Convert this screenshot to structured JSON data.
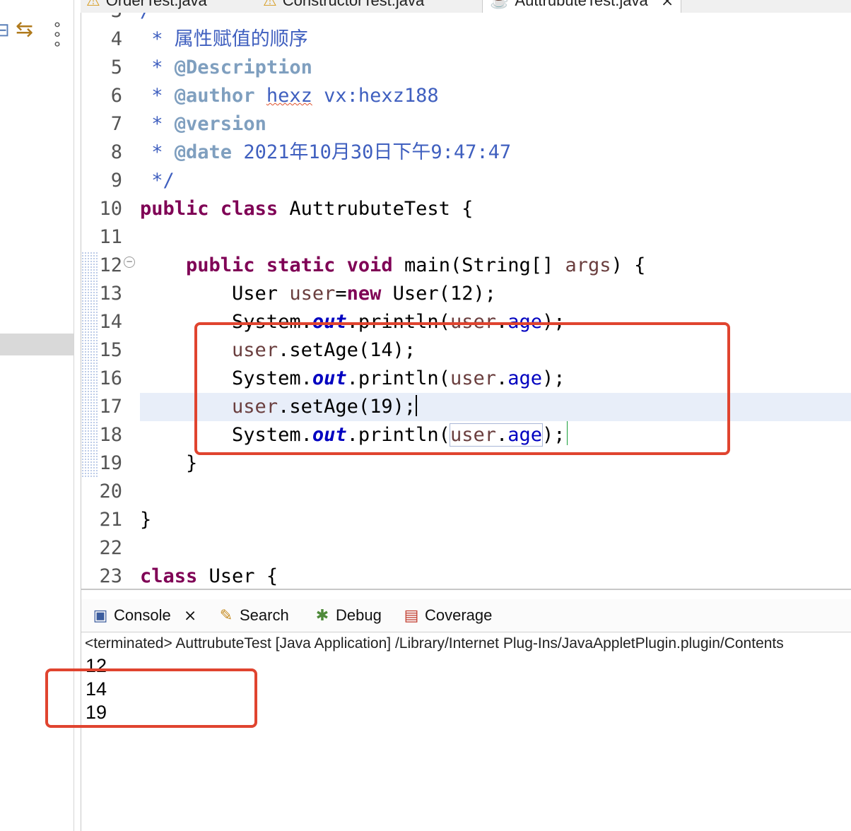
{
  "colors": {
    "highlight_box": "#e0442f",
    "keyword": "#7f0055",
    "comment": "#3f5fbf",
    "field": "#0000c0",
    "local_variable": "#6a3e3e",
    "current_line": "#e8eef9"
  },
  "left_panel": {
    "icons": [
      "collapse-all-icon",
      "link-with-editor-icon",
      "view-menu-icon"
    ]
  },
  "editor_tabs": [
    {
      "label": "OrderTest.java",
      "icon": "warning-icon",
      "active": false
    },
    {
      "label": "ConstructorTest.java",
      "icon": "warning-icon",
      "active": false
    },
    {
      "label": "AuttrubuteTest.java",
      "icon": "java-file-icon",
      "active": true,
      "close": "⨯"
    }
  ],
  "editor": {
    "lines": [
      {
        "num": "4",
        "text": " * 属性赋值的顺序"
      },
      {
        "num": "5",
        "text": " * @Description"
      },
      {
        "num": "6",
        "text": " * @author hexz vx:hexz188"
      },
      {
        "num": "7",
        "text": " * @version"
      },
      {
        "num": "8",
        "text": " * @date 2021年10月30日下午9:47:47"
      },
      {
        "num": "9",
        "text": " */"
      },
      {
        "num": "10",
        "text": "public class AuttrubuteTest {"
      },
      {
        "num": "11",
        "text": ""
      },
      {
        "num": "12",
        "text": "    public static void main(String[] args) {"
      },
      {
        "num": "13",
        "text": "        User user=new User(12);"
      },
      {
        "num": "14",
        "text": "        System.out.println(user.age);"
      },
      {
        "num": "15",
        "text": "        user.setAge(14);"
      },
      {
        "num": "16",
        "text": "        System.out.println(user.age);"
      },
      {
        "num": "17",
        "text": "        user.setAge(19);"
      },
      {
        "num": "18",
        "text": "        System.out.println(user.age);"
      },
      {
        "num": "19",
        "text": "    }"
      },
      {
        "num": "20",
        "text": ""
      },
      {
        "num": "21",
        "text": "}"
      },
      {
        "num": "22",
        "text": ""
      },
      {
        "num": "23",
        "text": "class User {"
      }
    ],
    "tokens": {
      "l4": [
        " * ",
        "属性赋值的顺序"
      ],
      "l5": [
        " * ",
        "@Description"
      ],
      "l6": [
        " * ",
        "@author",
        " ",
        "hexz",
        " vx:hexz188"
      ],
      "l7": [
        " * ",
        "@version"
      ],
      "l8": [
        " * ",
        "@date",
        " 2021年10月30日下午9:47:47"
      ],
      "l9": [
        " */"
      ],
      "l10": [
        "public",
        " ",
        "class",
        " AuttrubuteTest {"
      ],
      "l12": [
        "    ",
        "public",
        " ",
        "static",
        " ",
        "void",
        " main(String[] ",
        "args",
        ") {"
      ],
      "l13": [
        "        User ",
        "user",
        "=",
        "new",
        " User(12);"
      ],
      "l14": [
        "        System.",
        "out",
        ".println(",
        "user",
        ".",
        "age",
        ");"
      ],
      "l15": [
        "        ",
        "user",
        ".setAge(14);"
      ],
      "l16": [
        "        System.",
        "out",
        ".println(",
        "user",
        ".",
        "age",
        ");"
      ],
      "l17": [
        "        ",
        "user",
        ".setAge(19);"
      ],
      "l18": [
        "        System.",
        "out",
        ".println(",
        "user",
        ".",
        "age",
        ");"
      ],
      "l19": [
        "    }"
      ],
      "l21": [
        "}"
      ],
      "l23": [
        "class",
        " User {"
      ]
    }
  },
  "console": {
    "tabs": [
      {
        "label": "Console",
        "icon": "console-icon",
        "close": "⨯"
      },
      {
        "label": "Search",
        "icon": "search-flashlight-icon"
      },
      {
        "label": "Debug",
        "icon": "debug-bug-icon"
      },
      {
        "label": "Coverage",
        "icon": "coverage-icon"
      }
    ],
    "title": "<terminated> AuttrubuteTest [Java Application] /Library/Internet Plug-Ins/JavaAppletPlugin.plugin/Contents",
    "output": [
      "12",
      "14",
      "19"
    ]
  }
}
